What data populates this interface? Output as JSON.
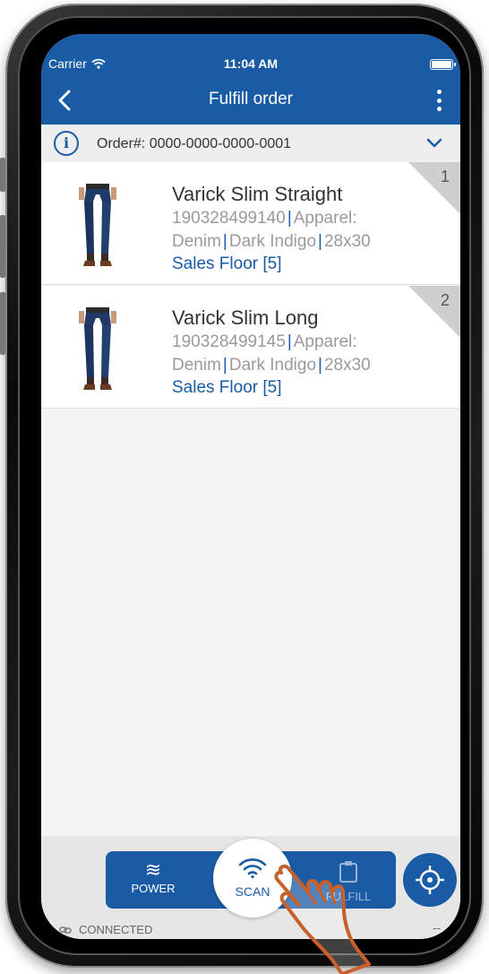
{
  "status_bar": {
    "carrier": "Carrier",
    "time": "11:04 AM"
  },
  "nav": {
    "title": "Fulfill order"
  },
  "order": {
    "label": "Order#: 0000-0000-0000-0001"
  },
  "items": [
    {
      "index": "1",
      "name": "Varick Slim Straight",
      "upc": "190328499140",
      "category": "Apparel:",
      "subcategory": "Denim",
      "color": "Dark Indigo",
      "size": "28x30",
      "location": "Sales Floor [5]"
    },
    {
      "index": "2",
      "name": "Varick Slim Long",
      "upc": "190328499145",
      "category": "Apparel:",
      "subcategory": "Denim",
      "color": "Dark Indigo",
      "size": "28x30",
      "location": "Sales Floor [5]"
    }
  ],
  "actions": {
    "power": "POWER",
    "scan": "SCAN",
    "fulfill": "FULFILL"
  },
  "footer": {
    "connection": "CONNECTED",
    "right": "--"
  },
  "colors": {
    "brand": "#1a5ba6",
    "hand": "#c8602a"
  },
  "icons": [
    "wifi-icon",
    "battery-icon",
    "back-arrow-icon",
    "more-icon",
    "info-icon",
    "chevron-down-icon",
    "power-waves-icon",
    "scan-wifi-icon",
    "clipboard-icon",
    "crosshair-icon",
    "link-icon",
    "pointing-hand-icon"
  ]
}
